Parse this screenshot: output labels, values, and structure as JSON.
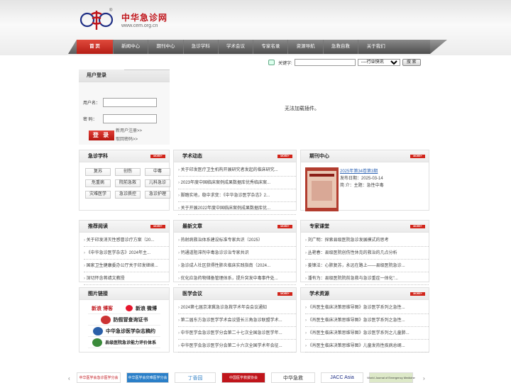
{
  "header": {
    "logo_text": "中华急诊网",
    "logo_url": "www.cem.org.cn",
    "reg_mark": "®"
  },
  "nav": [
    "首 页",
    "新闻中心",
    "期刊中心",
    "急诊学科",
    "学术会议",
    "专家名录",
    "资源导航",
    "急救自救",
    "关于我们"
  ],
  "search": {
    "label": "关键字:",
    "value": "",
    "select_value": "----行业快讯",
    "button": "搜 索"
  },
  "login": {
    "title": "用户登录",
    "user_label": "用户名：",
    "pass_label": "密  码：",
    "button": "登 录",
    "register": "新用户注册>>",
    "forgot": "取回密码>>"
  },
  "plugin_message": "无法加载插件。",
  "more_label": "MORE+",
  "sections": {
    "subjects": {
      "title": "急诊学科",
      "items": [
        "复苏",
        "创伤",
        "中毒",
        "危重病",
        "院前急救",
        "儿科急诊",
        "灾难医学",
        "急诊质控",
        "急诊护理"
      ]
    },
    "academic": {
      "title": "学术动态",
      "items": [
        "关于印发医疗卫生机构开展研究者发起的临床研究...",
        "2023年度中国临床案例成果数据库优秀临床案...",
        "脚踏实地，稳中求变：《中华急诊医学杂志》2...",
        "关于开展2022年度中国临床案例成果数据库优..."
      ]
    },
    "journal": {
      "title": "期刊中心",
      "issue": "2025年第34卷第3期",
      "date": "发布日期：2025-03-14",
      "intro": "简     介：主题：急性中毒"
    },
    "recommend": {
      "title": "推荐阅读",
      "items": [
        "关于印发消灭性感冒诊疗方案（20...",
        "《中华急诊医学杂志》2024年主...",
        "国家卫生健康委办公厅关于印发继续...",
        "深切怀念蒋靖文教授"
      ]
    },
    "latest": {
      "title": "最新文章",
      "items": [
        "热射病救治体系建设标准专家共识（2025）",
        "钙通道阻滞剂中毒急诊诊治专家共识",
        "急诊成人社区获得性肺炎临床实践指南（2024...",
        "优化应急药物储备管理体系，提升突发中毒事件处..."
      ]
    },
    "expert": {
      "title": "专家课堂",
      "items": [
        "刘广明：探索县级医院急诊发展模式的思考",
        "丛艳春：县级医院创伤性休克的救治的几点分析",
        "姜锋法：心肺复苏，永远在路上——县级医院急诊...",
        "潘有为：县级医院院前急救与急诊重症一体化\"..."
      ]
    },
    "links": {
      "title": "图片链接",
      "items": [
        "新浪 博客",
        "新浪 微博",
        "防假冒查询证书",
        "中华急诊医学杂志稿约",
        "县级医院急诊能力评价体系"
      ]
    },
    "conference": {
      "title": "医学会议",
      "items": [
        "2024第七届京津冀急诊急救学术年会会议通知",
        "第二届东方急诊医学学术会议暨长三角急诊联盟学术...",
        "中华医学会急诊医学分会第二十七次全国急诊医学年...",
        "中华医学会急诊医学分会第二十六次全国学术年会征..."
      ]
    },
    "resources": {
      "title": "学术资源",
      "items": [
        "《肖医生临床决策思维导图》急诊医学系列之急性...",
        "《肖医生临床决策思维导图》急诊医学系列之急性...",
        "《肖医生临床决策思维导图》急诊医学系列之儿童肺...",
        "《肖医生临床决策思维导图》儿童发热性疾病总纲..."
      ]
    }
  },
  "footer_logos": [
    "中华医学会急诊医学分会",
    "中华医学会灾难医学分会",
    "丁香园",
    "中国医学救援协会",
    "中华急救",
    "JACC Asia",
    "World Journal of Emergency Medicine"
  ],
  "colors": {
    "brand_red": "#c0151b",
    "nav_gray": "#5e5e5e"
  }
}
